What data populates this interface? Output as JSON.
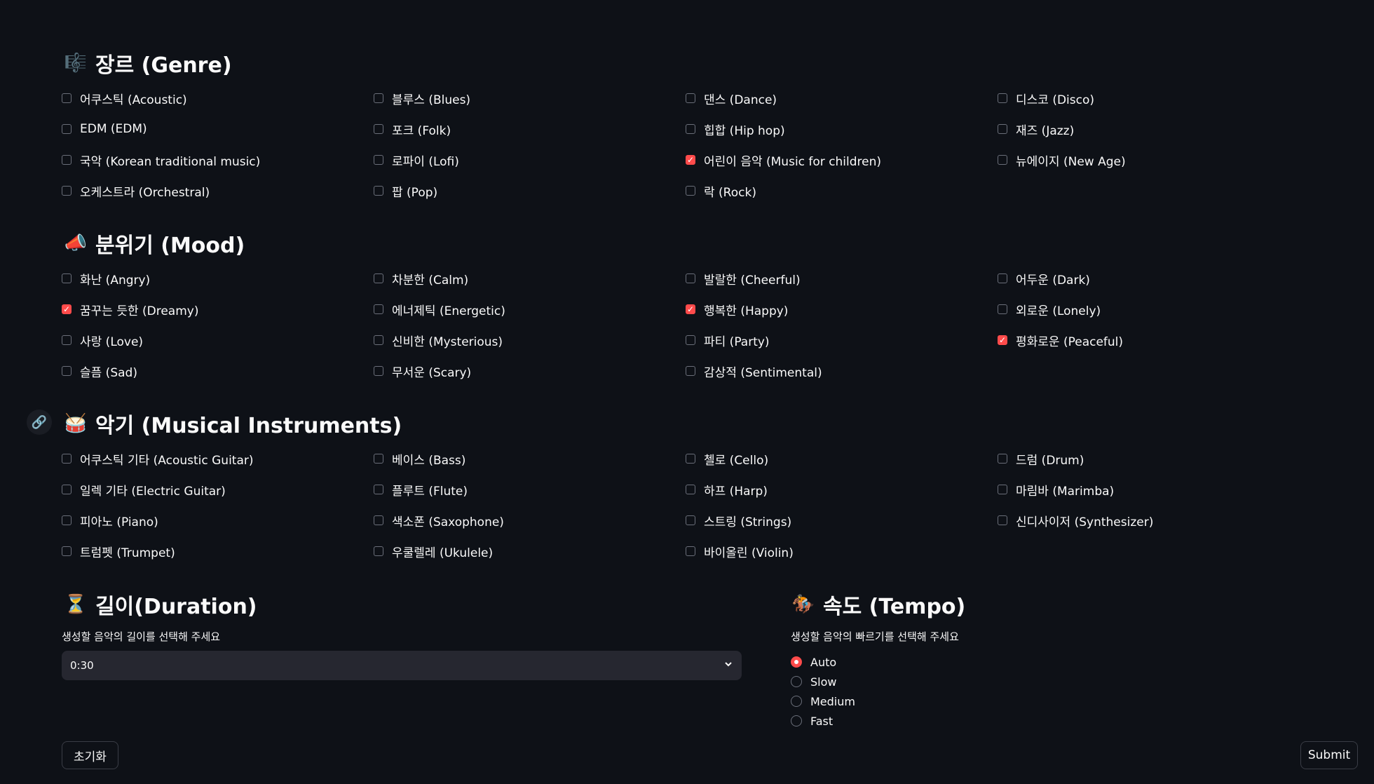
{
  "genre": {
    "title": "장르 (Genre)",
    "icon": "🎼",
    "rows": [
      [
        {
          "label": "어쿠스틱 (Acoustic)",
          "checked": false
        },
        {
          "label": "블루스 (Blues)",
          "checked": false
        },
        {
          "label": "댄스 (Dance)",
          "checked": false
        },
        {
          "label": "디스코 (Disco)",
          "checked": false
        }
      ],
      [
        {
          "label": "EDM (EDM)",
          "checked": false
        },
        {
          "label": "포크 (Folk)",
          "checked": false
        },
        {
          "label": "힙합 (Hip hop)",
          "checked": false
        },
        {
          "label": "재즈 (Jazz)",
          "checked": false
        }
      ],
      [
        {
          "label": "국악 (Korean traditional music)",
          "checked": false
        },
        {
          "label": "로파이 (Lofi)",
          "checked": false
        },
        {
          "label": "어린이 음악 (Music for children)",
          "checked": true
        },
        {
          "label": "뉴에이지 (New Age)",
          "checked": false
        }
      ],
      [
        {
          "label": "오케스트라 (Orchestral)",
          "checked": false
        },
        {
          "label": "팝 (Pop)",
          "checked": false
        },
        {
          "label": "락 (Rock)",
          "checked": false
        },
        null
      ]
    ]
  },
  "mood": {
    "title": "분위기 (Mood)",
    "icon": "📣",
    "rows": [
      [
        {
          "label": "화난 (Angry)",
          "checked": false
        },
        {
          "label": "차분한 (Calm)",
          "checked": false
        },
        {
          "label": "발랄한 (Cheerful)",
          "checked": false
        },
        {
          "label": "어두운 (Dark)",
          "checked": false
        }
      ],
      [
        {
          "label": "꿈꾸는 듯한 (Dreamy)",
          "checked": true
        },
        {
          "label": "에너제틱 (Energetic)",
          "checked": false
        },
        {
          "label": "행복한 (Happy)",
          "checked": true
        },
        {
          "label": "외로운 (Lonely)",
          "checked": false
        }
      ],
      [
        {
          "label": "사랑 (Love)",
          "checked": false
        },
        {
          "label": "신비한 (Mysterious)",
          "checked": false
        },
        {
          "label": "파티 (Party)",
          "checked": false
        },
        {
          "label": "평화로운 (Peaceful)",
          "checked": true
        }
      ],
      [
        {
          "label": "슬픔 (Sad)",
          "checked": false
        },
        {
          "label": "무서운 (Scary)",
          "checked": false
        },
        {
          "label": "감상적 (Sentimental)",
          "checked": false
        },
        null
      ]
    ]
  },
  "instruments": {
    "title": "악기 (Musical Instruments)",
    "icon": "🥁",
    "rows": [
      [
        {
          "label": "어쿠스틱 기타 (Acoustic Guitar)",
          "checked": false
        },
        {
          "label": "베이스 (Bass)",
          "checked": false
        },
        {
          "label": "첼로 (Cello)",
          "checked": false
        },
        {
          "label": "드럼 (Drum)",
          "checked": false
        }
      ],
      [
        {
          "label": "일렉 기타 (Electric Guitar)",
          "checked": false
        },
        {
          "label": "플루트 (Flute)",
          "checked": false
        },
        {
          "label": "하프 (Harp)",
          "checked": false
        },
        {
          "label": "마림바 (Marimba)",
          "checked": false
        }
      ],
      [
        {
          "label": "피아노 (Piano)",
          "checked": false
        },
        {
          "label": "색소폰 (Saxophone)",
          "checked": false
        },
        {
          "label": "스트링 (Strings)",
          "checked": false
        },
        {
          "label": "신디사이저 (Synthesizer)",
          "checked": false
        }
      ],
      [
        {
          "label": "트럼펫 (Trumpet)",
          "checked": false
        },
        {
          "label": "우쿨렐레 (Ukulele)",
          "checked": false
        },
        {
          "label": "바이올린 (Violin)",
          "checked": false
        },
        null
      ]
    ]
  },
  "duration": {
    "title": "길이(Duration)",
    "icon": "⏳",
    "caption": "생성할 음악의 길이를 선택해 주세요",
    "selected": "0:30"
  },
  "tempo": {
    "title": "속도 (Tempo)",
    "icon": "🏇",
    "caption": "생성할 음악의 빠르기를 선택해 주세요",
    "options": [
      "Auto",
      "Slow",
      "Medium",
      "Fast"
    ],
    "selected": "Auto"
  },
  "buttons": {
    "reset": "초기화",
    "submit": "Submit"
  },
  "colors": {
    "background": "#0e1117",
    "accent": "#ff4b4b",
    "input_bg": "#262730"
  }
}
